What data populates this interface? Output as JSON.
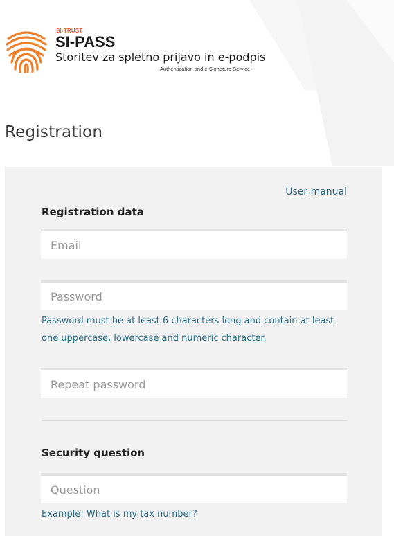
{
  "header": {
    "brand_small": "SI-TRUST",
    "brand_title": "SI-PASS",
    "tagline": "Storitev za spletno prijavo in e-podpis",
    "subtitle": "Authentication and e-Signature Service",
    "logo_icon": "fingerprint-icon",
    "logo_color": "#f07f2a"
  },
  "page": {
    "title": "Registration"
  },
  "form": {
    "user_manual_link": "User manual",
    "registration_heading": "Registration data",
    "email": {
      "value": "",
      "placeholder": "Email"
    },
    "password": {
      "value": "",
      "placeholder": "Password"
    },
    "password_hint": "Password must be at least 6 characters long and contain at least one uppercase, lowercase and numeric character.",
    "repeat_password": {
      "value": "",
      "placeholder": "Repeat password"
    },
    "security_heading": "Security question",
    "question": {
      "value": "",
      "placeholder": "Question"
    },
    "question_hint": "Example: What is my tax number?"
  },
  "colors": {
    "link": "#2a5d73",
    "hint": "#2a6e8a",
    "panel_bg": "#f2f2f2",
    "brand_accent": "#e4572e"
  }
}
